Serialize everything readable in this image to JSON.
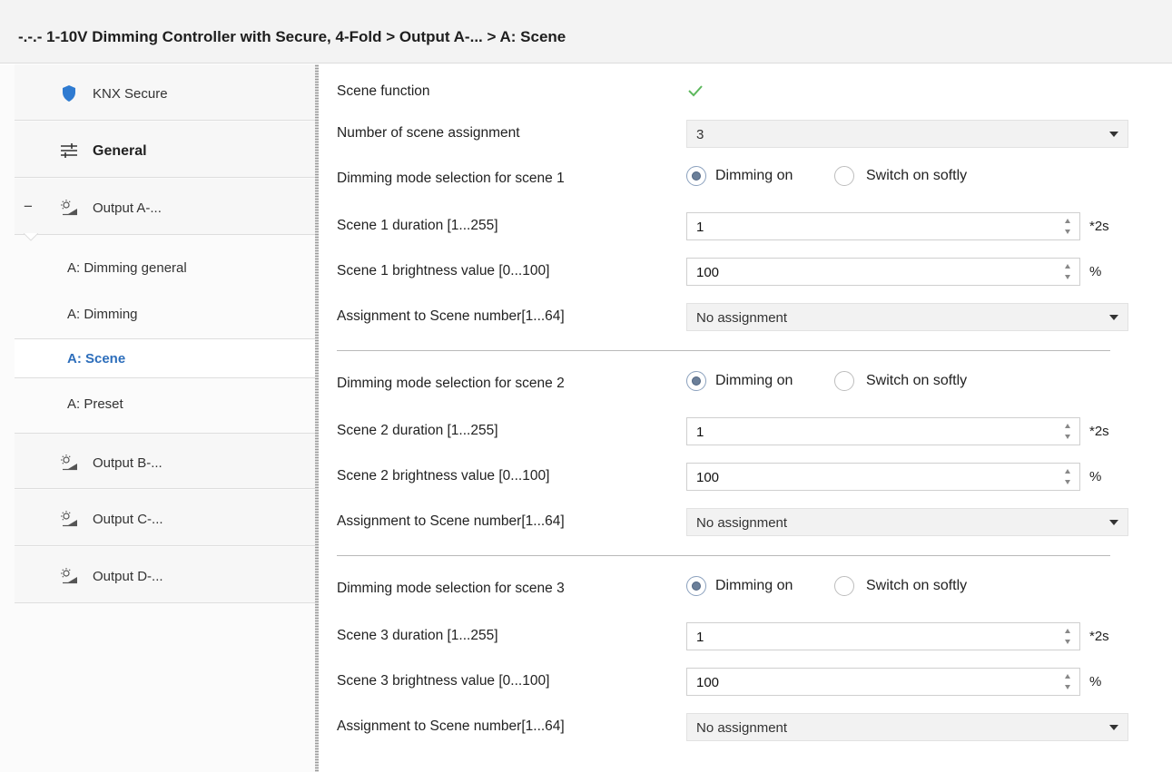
{
  "breadcrumb": "-.-.- 1-10V Dimming Controller with Secure, 4-Fold > Output A-... > A: Scene",
  "sidebar": {
    "groups": [
      {
        "label": "KNX Secure",
        "icon": "shield-icon"
      },
      {
        "label": "General",
        "icon": "sliders-icon"
      },
      {
        "label": "Output A-...",
        "icon": "lamp-icon",
        "expanded": true,
        "collapse_symbol": "−"
      },
      {
        "label": "Output B-...",
        "icon": "lamp-icon"
      },
      {
        "label": "Output C-...",
        "icon": "lamp-icon"
      },
      {
        "label": "Output D-...",
        "icon": "lamp-icon"
      }
    ],
    "subitems": [
      {
        "label": "A: Dimming general"
      },
      {
        "label": "A: Dimming"
      },
      {
        "label": "A: Scene",
        "active": true
      },
      {
        "label": "A: Preset"
      }
    ]
  },
  "params": {
    "scene_function": {
      "label": "Scene function",
      "checked": true
    },
    "num_assignment": {
      "label": "Number of scene assignment",
      "value": "3"
    },
    "scenes": [
      {
        "mode_label": "Dimming mode selection for scene 1",
        "opt_on": "Dimming on",
        "opt_soft": "Switch on softly",
        "selected": "Dimming on",
        "duration_label": "Scene 1 duration [1...255]",
        "duration": "1",
        "duration_unit": "*2s",
        "brightness_label": "Scene 1 brightness value [0...100]",
        "brightness": "100",
        "brightness_unit": "%",
        "assign_label": "Assignment to Scene number[1...64]",
        "assign": "No assignment"
      },
      {
        "mode_label": "Dimming mode selection for scene 2",
        "opt_on": "Dimming on",
        "opt_soft": "Switch on softly",
        "selected": "Dimming on",
        "duration_label": "Scene 2 duration [1...255]",
        "duration": "1",
        "duration_unit": "*2s",
        "brightness_label": "Scene 2 brightness value [0...100]",
        "brightness": "100",
        "brightness_unit": "%",
        "assign_label": "Assignment to Scene number[1...64]",
        "assign": "No assignment"
      },
      {
        "mode_label": "Dimming mode selection for scene 3",
        "opt_on": "Dimming on",
        "opt_soft": "Switch on softly",
        "selected": "Dimming on",
        "duration_label": "Scene 3 duration [1...255]",
        "duration": "1",
        "duration_unit": "*2s",
        "brightness_label": "Scene 3 brightness value [0...100]",
        "brightness": "100",
        "brightness_unit": "%",
        "assign_label": "Assignment to Scene number[1...64]",
        "assign": "No assignment"
      }
    ]
  },
  "colors": {
    "accent": "#2d6ebb",
    "check": "#5cb85c",
    "shield": "#2f7bd1"
  }
}
